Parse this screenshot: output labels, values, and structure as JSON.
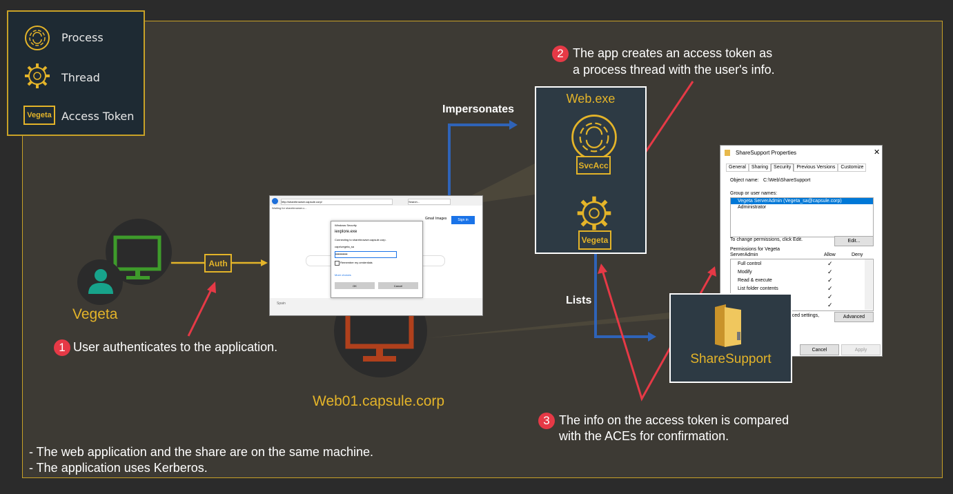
{
  "legend": {
    "process": "Process",
    "thread": "Thread",
    "token_word": "Vegeta",
    "access_token": "Access Token"
  },
  "user": {
    "name": "Vegeta"
  },
  "auth_label": "Auth",
  "server": {
    "name": "Web01.capsule.corp"
  },
  "labels": {
    "impersonates": "Impersonates",
    "lists": "Lists"
  },
  "webexe": {
    "title": "Web.exe",
    "svc_token": "SvcAcc",
    "user_token": "Vegeta"
  },
  "share": {
    "name": "ShareSupport"
  },
  "steps": {
    "s1": {
      "num": "1",
      "text": "User authenticates to the application."
    },
    "s2": {
      "num": "2",
      "line1": "The app creates an access token as",
      "line2": "a process thread with the user's info."
    },
    "s3": {
      "num": "3",
      "line1": "The info on the access token is compared",
      "line2": "with the ACEs for confirmation."
    }
  },
  "notes": [
    "- The web application and the share are on the same machine.",
    "- The application uses Kerberos."
  ],
  "browser": {
    "url": "http://sharebrowser.capsule.corp/",
    "search_placeholder": "Search...",
    "tab": "Waiting for sharebrowser.c...",
    "links": {
      "gmail": "Gmail",
      "images": "Images"
    },
    "signin": "Sign in",
    "footer": "Spain",
    "dialog": {
      "title": "Windows Security",
      "app": "iexplore.exe",
      "connecting": "Connecting to sharebrowser.capsule.corp.",
      "username": "caps\\vegeta_sa",
      "password": "••••••••••",
      "remember": "Remember my credentials",
      "more": "More choices",
      "ok": "OK",
      "cancel": "Cancel"
    }
  },
  "props": {
    "title": "ShareSupport Properties",
    "tabs": [
      "General",
      "Sharing",
      "Security",
      "Previous Versions",
      "Customize"
    ],
    "object_label": "Object name:",
    "object_value": "C:\\Web\\ShareSupport",
    "group_label": "Group or user names:",
    "users": [
      "Vegeta ServerAdmin (Vegeta_sa@capsule.corp)",
      "Administrator"
    ],
    "change_text": "To change permissions, click Edit.",
    "edit": "Edit...",
    "perm_for_1": "Permissions for Vegeta",
    "perm_for_2": "ServerAdmin",
    "allow": "Allow",
    "deny": "Deny",
    "perms": [
      "Full control",
      "Modify",
      "Read & execute",
      "List folder contents",
      "",
      ""
    ],
    "check": "✓",
    "adv_text": "anced settings,",
    "advanced": "Advanced",
    "cancel": "Cancel",
    "apply": "Apply"
  }
}
